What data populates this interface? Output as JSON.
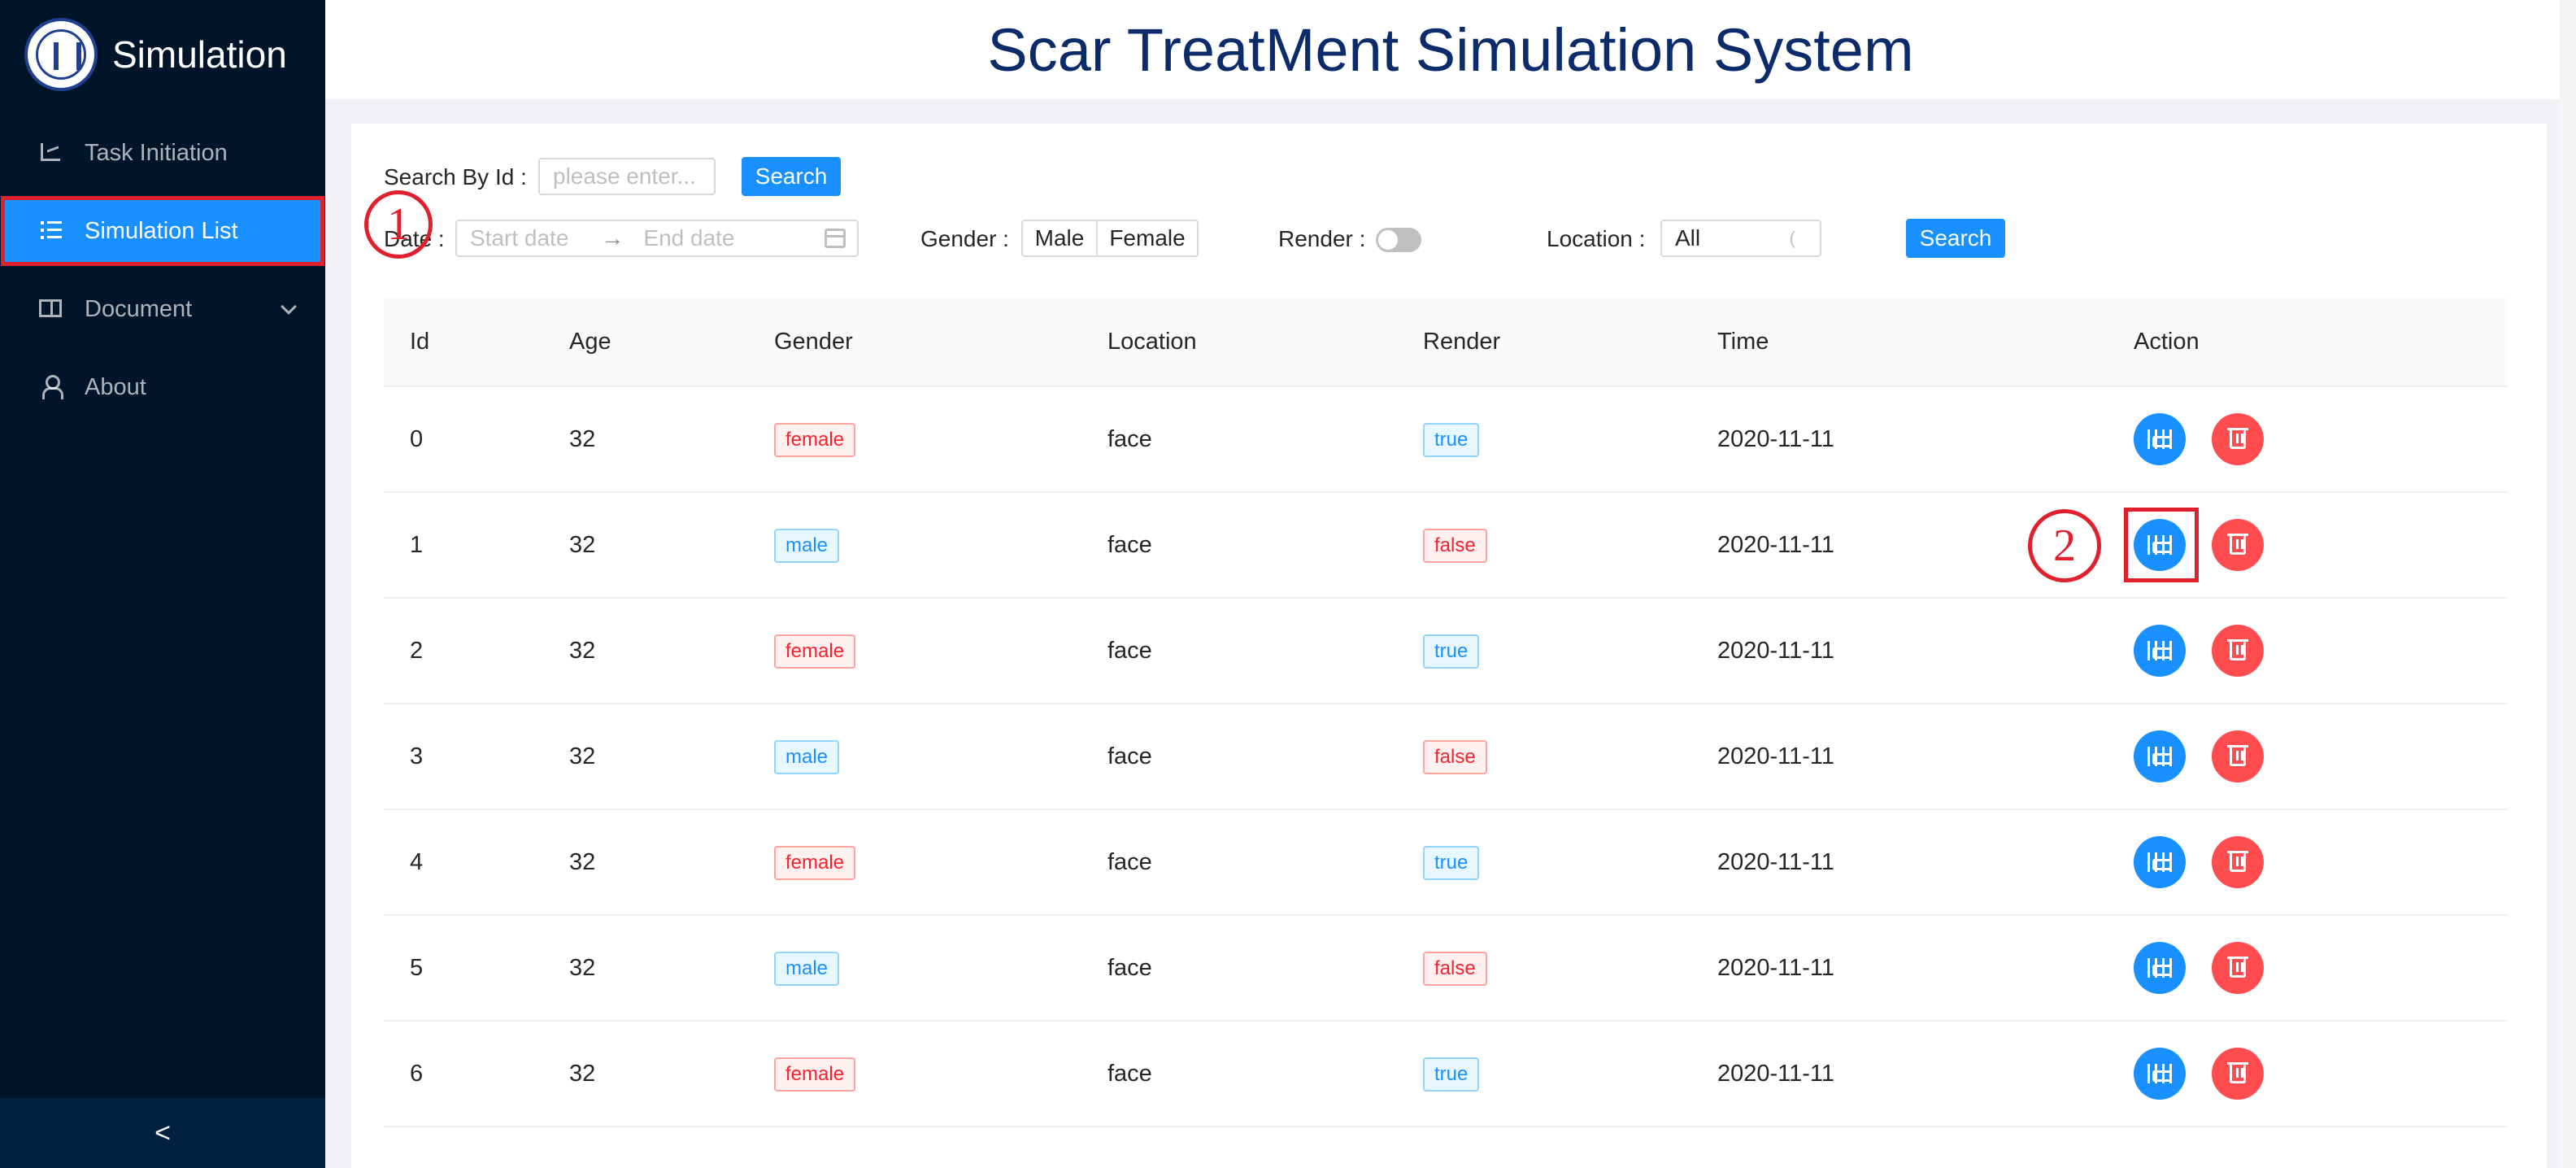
{
  "app": {
    "name": "Simulation",
    "page_title": "Scar TreatMent Simulation System"
  },
  "sidebar": {
    "items": [
      {
        "label": "Task Initiation",
        "icon": "chart-icon"
      },
      {
        "label": "Simulation List",
        "icon": "list-icon",
        "active": true
      },
      {
        "label": "Document",
        "icon": "book-icon",
        "has_submenu": true
      },
      {
        "label": "About",
        "icon": "user-icon"
      }
    ],
    "collapse_glyph": "<"
  },
  "filters": {
    "search_id_label": "Search By Id",
    "search_id_placeholder": "please enter...",
    "search_button": "Search",
    "date_label": "Date",
    "start_date_placeholder": "Start date",
    "end_date_placeholder": "End date",
    "date_arrow": "→",
    "gender_label": "Gender",
    "gender_options": [
      "Male",
      "Female"
    ],
    "render_label": "Render",
    "render_enabled": false,
    "location_label": "Location",
    "location_value": "All",
    "search_button_2": "Search"
  },
  "table": {
    "columns": [
      "Id",
      "Age",
      "Gender",
      "Location",
      "Render",
      "Time",
      "Action"
    ],
    "rows": [
      {
        "id": "0",
        "age": "32",
        "gender": "female",
        "location": "face",
        "render": "true",
        "time": "2020-11-11"
      },
      {
        "id": "1",
        "age": "32",
        "gender": "male",
        "location": "face",
        "render": "false",
        "time": "2020-11-11"
      },
      {
        "id": "2",
        "age": "32",
        "gender": "female",
        "location": "face",
        "render": "true",
        "time": "2020-11-11"
      },
      {
        "id": "3",
        "age": "32",
        "gender": "male",
        "location": "face",
        "render": "false",
        "time": "2020-11-11"
      },
      {
        "id": "4",
        "age": "32",
        "gender": "female",
        "location": "face",
        "render": "true",
        "time": "2020-11-11"
      },
      {
        "id": "5",
        "age": "32",
        "gender": "male",
        "location": "face",
        "render": "false",
        "time": "2020-11-11"
      },
      {
        "id": "6",
        "age": "32",
        "gender": "female",
        "location": "face",
        "render": "true",
        "time": "2020-11-11"
      }
    ]
  },
  "annotations": {
    "mark_1": "1",
    "mark_2": "2",
    "color": "#e0202d"
  },
  "colors": {
    "primary": "#1890ff",
    "sidebar": "#001529",
    "danger": "#ff4d4f",
    "title": "#0c2b6b"
  }
}
